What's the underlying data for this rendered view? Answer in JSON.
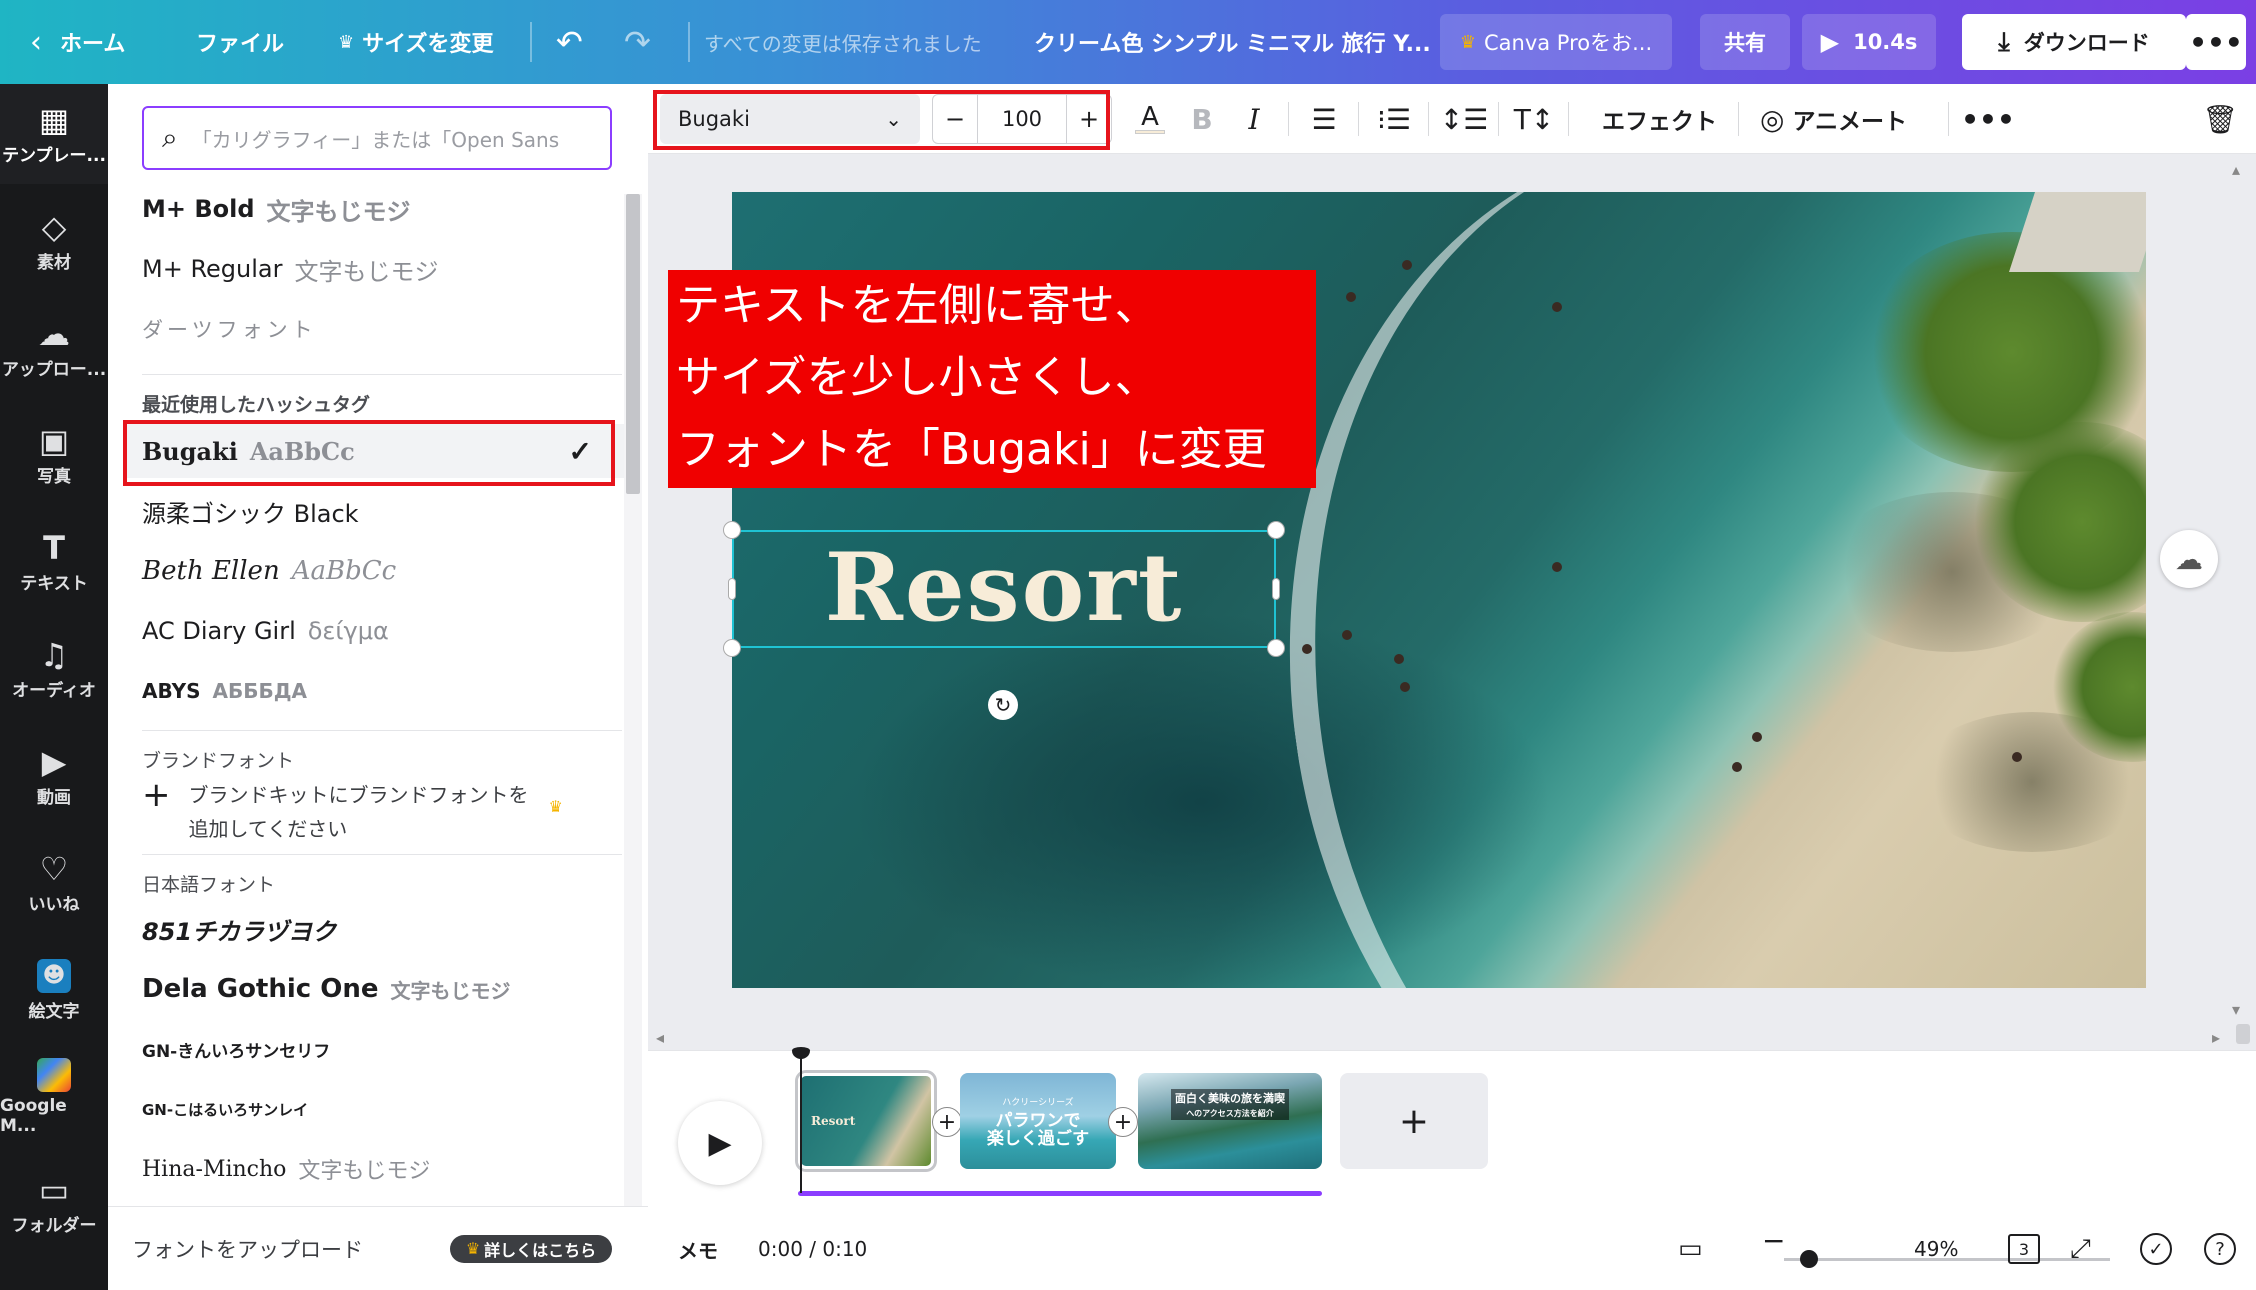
{
  "topbar": {
    "home": "ホーム",
    "file": "ファイル",
    "resize": "サイズを変更",
    "saved_status": "すべての変更は保存されました",
    "title": "クリーム色 シンプル ミニマル 旅行 Y...",
    "pro": "Canva Proをお...",
    "share": "共有",
    "play_duration": "10.4s",
    "download": "ダウンロード",
    "more": "•••"
  },
  "rail": [
    {
      "label": "テンプレー...",
      "icon": "templates-icon"
    },
    {
      "label": "素材",
      "icon": "elements-icon"
    },
    {
      "label": "アップロー...",
      "icon": "upload-icon"
    },
    {
      "label": "写真",
      "icon": "photo-icon"
    },
    {
      "label": "テキスト",
      "icon": "text-icon"
    },
    {
      "label": "オーディオ",
      "icon": "audio-icon"
    },
    {
      "label": "動画",
      "icon": "video-icon"
    },
    {
      "label": "いいね",
      "icon": "heart-icon"
    },
    {
      "label": "絵文字",
      "icon": "emoji-icon"
    },
    {
      "label": "Google M...",
      "icon": "google-maps-icon"
    },
    {
      "label": "フォルダー",
      "icon": "folder-icon"
    }
  ],
  "font_panel": {
    "search_placeholder": "「カリグラフィー」または「Open Sans",
    "top_fonts": [
      {
        "name": "M+ Bold",
        "sample": "文字もじモジ"
      },
      {
        "name": "M+ Regular",
        "sample": "文字もじモジ"
      },
      {
        "name": "ダーツフォント",
        "sample": ""
      }
    ],
    "recent_label": "最近使用したハッシュタグ",
    "recent_fonts": [
      {
        "name": "Bugaki",
        "sample": "AaBbCc",
        "selected": true
      },
      {
        "name": "源柔ゴシック Black",
        "sample": ""
      },
      {
        "name": "Beth Ellen",
        "sample": "AaBbCc"
      },
      {
        "name": "AC Diary Girl",
        "sample": "δείγμα"
      },
      {
        "name": "ABYS",
        "sample": "АБББДА"
      }
    ],
    "brand_label": "ブランドフォント",
    "brand_add_line1": "ブランドキットにブランドフォントを",
    "brand_add_line2": "追加してください",
    "japanese_label": "日本語フォント",
    "japanese_fonts": [
      {
        "name": "851チカラヅヨク",
        "sample": ""
      },
      {
        "name": "Dela Gothic One",
        "sample": "文字もじモジ"
      },
      {
        "name": "GN-きんいろサンセリフ",
        "sample": ""
      },
      {
        "name": "GN-こはるいろサンレイ",
        "sample": ""
      },
      {
        "name": "Hina-Mincho",
        "sample": "文字もじモジ"
      }
    ],
    "upload_label": "フォントをアップロード",
    "upload_badge": "詳しくはこちら"
  },
  "toolbar": {
    "font_name": "Bugaki",
    "font_size": "100",
    "effect": "エフェクト",
    "animate": "アニメート"
  },
  "canvas": {
    "caption_lines": [
      "テキストを左側に寄せ、",
      "サイズを少し小さくし、",
      "フォントを「Bugaki」に変更"
    ],
    "resort_text": "Resort"
  },
  "timeline": {
    "clip1_text": "Resort",
    "clip2_line1": "パラワンで",
    "clip2_line2": "楽しく過ごす",
    "clip2_top": "ハクリーシリーズ",
    "clip3_line1": "面白く美味の旅を満喫",
    "clip3_line2": "へのアクセス方法を紹介"
  },
  "footer": {
    "memo": "メモ",
    "time": "0:00 / 0:10",
    "zoom": "49%",
    "pages": "3",
    "help": "?"
  },
  "colors": {
    "accent": "#8b3dff",
    "annotation_red": "#f00000",
    "selection": "#1fc3d3"
  }
}
